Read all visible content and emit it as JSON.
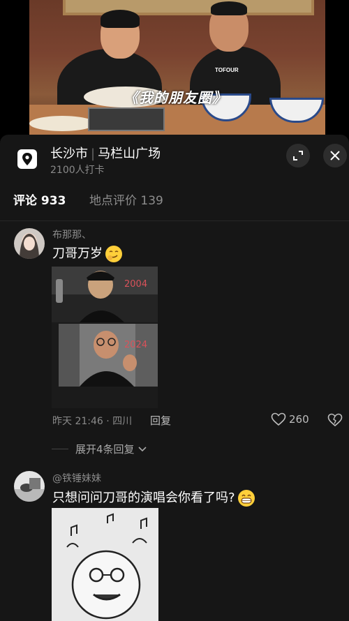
{
  "video": {
    "caption": "《我的朋友圈》",
    "shirt_text": "TOFOUR"
  },
  "location": {
    "city": "长沙市",
    "place": "马栏山广场",
    "checkins": "2100人打卡"
  },
  "tabs": {
    "comments": "评论 933",
    "reviews": "地点评价 139"
  },
  "comments": [
    {
      "username": "布那那、",
      "text": "刀哥万岁",
      "image_labels": [
        "2004",
        "2024"
      ],
      "time_location": "昨天 21:46 · 四川",
      "reply_label": "回复",
      "likes": "260",
      "expand_label": "展开4条回复"
    },
    {
      "username": "@铁锤妹妹",
      "text": "只想问问刀哥的演唱会你看了吗?"
    }
  ],
  "colors": {
    "panel_bg": "#161616",
    "muted_text": "#8a8a8a",
    "emoji_yellow": "#ffcf3a"
  }
}
